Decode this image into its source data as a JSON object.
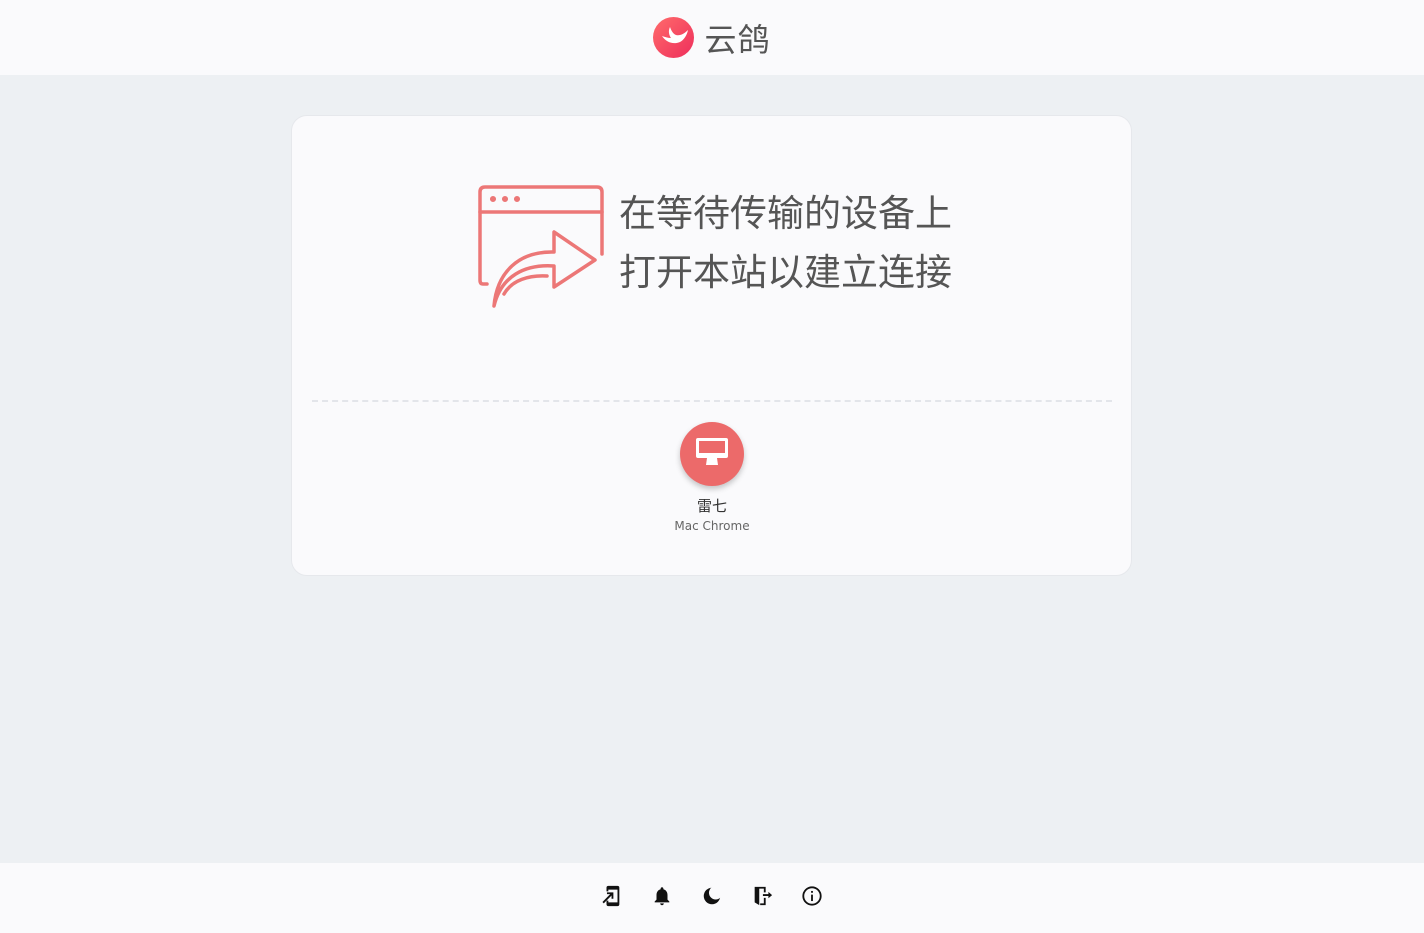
{
  "header": {
    "brand_name": "云鸽",
    "logo_icon": "pigeon-logo-icon"
  },
  "hero": {
    "illustration_icon": "browser-share-icon",
    "line1": "在等待传输的设备上",
    "line2": "打开本站以建立连接"
  },
  "devices": [
    {
      "name": "雷七",
      "desc": "Mac Chrome",
      "icon": "desktop-monitor-icon"
    }
  ],
  "footer": {
    "buttons": [
      {
        "icon": "pair-device-icon"
      },
      {
        "icon": "bell-icon"
      },
      {
        "icon": "moon-icon"
      },
      {
        "icon": "logout-door-icon"
      },
      {
        "icon": "info-icon"
      }
    ]
  },
  "colors": {
    "accent": "#ec6a6a",
    "logo_gradient_start": "#ff6b6b",
    "logo_gradient_end": "#ee2e5c",
    "page_background": "#edf0f3",
    "surface": "#fafafc"
  }
}
